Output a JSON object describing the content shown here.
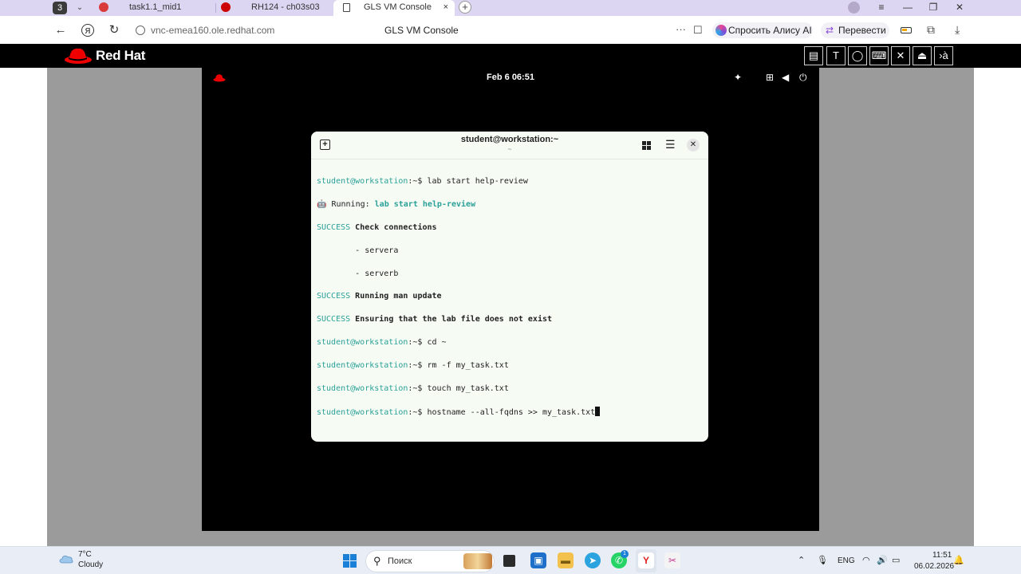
{
  "browser": {
    "tab_counter": "3",
    "tabs": [
      {
        "label": "task1.1_mid1",
        "favicon_color": "#d93b3b"
      },
      {
        "label": "RH124 - ch03s03",
        "favicon_color": "#cc0000"
      },
      {
        "label": "GLS VM Console",
        "favicon_color": "#555555",
        "active": true
      }
    ],
    "tab_close": "×",
    "new_tab": "+",
    "window_controls": {
      "menu": "≡",
      "minimize": "—",
      "restore": "❐",
      "close": "✕"
    },
    "url": "vnc-emea160.ole.redhat.com",
    "page_title": "GLS VM Console",
    "more": "···",
    "alice_button": "Спросить Алису AI",
    "translate_button": "Перевести"
  },
  "redhat": {
    "logo_text": "Red Hat",
    "brand_color": "#ee0000",
    "toolbar": [
      "▤",
      "T",
      "◯",
      "⌨",
      "✕",
      "⏏",
      "›à"
    ]
  },
  "gnome": {
    "clock": "Feb 6  06:51"
  },
  "terminal": {
    "title": "student@workstation:~",
    "subtitle": "~",
    "lines": [
      {
        "prompt": "student@workstation",
        "path": ":~$ ",
        "cmd": "lab start help-review"
      },
      {
        "prefix": "🤖 Running: ",
        "highlight": "lab start help-review"
      },
      {
        "status": "SUCCESS",
        "text": " Check connections"
      },
      {
        "indent": "        - servera"
      },
      {
        "indent": "        - serverb"
      },
      {
        "status": "SUCCESS",
        "text": " Running man update"
      },
      {
        "status": "SUCCESS",
        "text": " Ensuring that the lab file does not exist"
      },
      {
        "prompt": "student@workstation",
        "path": ":~$ ",
        "cmd": "cd ~"
      },
      {
        "prompt": "student@workstation",
        "path": ":~$ ",
        "cmd": "rm -f my_task.txt"
      },
      {
        "prompt": "student@workstation",
        "path": ":~$ ",
        "cmd": "touch my_task.txt"
      },
      {
        "prompt": "student@workstation",
        "path": ":~$ ",
        "cmd": "hostname --all-fqdns >> my_task.txt"
      }
    ]
  },
  "taskbar": {
    "weather_temp": "7°C",
    "weather_desc": "Cloudy",
    "search_placeholder": "Поиск",
    "whatsapp_badge": "1",
    "language": "ENG",
    "time": "11:51",
    "date": "06.02.2026"
  }
}
